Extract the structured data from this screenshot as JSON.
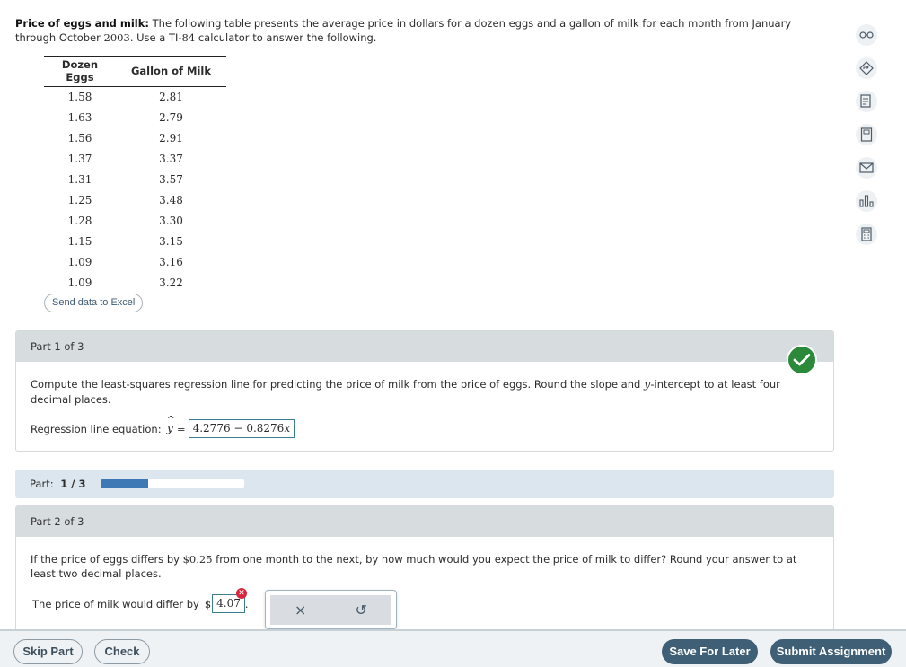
{
  "intro": {
    "title": "Price of eggs and milk:",
    "text_a": " The following table presents the average price in dollars for a dozen eggs and a gallon of milk for each month from January through October ",
    "year": "2003",
    "text_b": ". Use a TI-",
    "model": "84",
    "text_c": " calculator to answer the following."
  },
  "table": {
    "headers": [
      "Dozen Eggs",
      "Gallon of Milk"
    ],
    "rows": [
      [
        "1.58",
        "2.81"
      ],
      [
        "1.63",
        "2.79"
      ],
      [
        "1.56",
        "2.91"
      ],
      [
        "1.37",
        "3.37"
      ],
      [
        "1.31",
        "3.57"
      ],
      [
        "1.25",
        "3.48"
      ],
      [
        "1.28",
        "3.30"
      ],
      [
        "1.15",
        "3.15"
      ],
      [
        "1.09",
        "3.16"
      ],
      [
        "1.09",
        "3.22"
      ]
    ]
  },
  "send_excel_label": "Send data to Excel",
  "part1": {
    "heading": "Part 1 of 3",
    "q_a": "Compute the least-squares regression line for predicting the price of milk from the price of eggs. Round the slope and ",
    "q_var": "y",
    "q_b": "-intercept to at least four decimal places.",
    "eq_label": "Regression line equation:",
    "yhat_var": "y",
    "yhat_hat": "^",
    "equals": "=",
    "answer_intercept": "4.2776",
    "answer_minus": "−",
    "answer_slope": "0.8276",
    "answer_x": "x",
    "status": "correct"
  },
  "progress": {
    "label": "Part:",
    "value_text": "1 / 3",
    "fraction": 0.3333
  },
  "part2": {
    "heading": "Part 2 of 3",
    "q_a": "If the price of eggs differs by ",
    "q_amount": "$0.25",
    "q_b": " from one month to the next, by how much would you expect the price of milk to differ? Round your answer to at least two decimal places.",
    "answer_label": "The price of milk would differ by",
    "currency": "$",
    "answer_value": "4.07",
    "answer_suffix": ".",
    "status": "incorrect"
  },
  "popup": {
    "clear_icon": "×",
    "undo_icon": "↺"
  },
  "footer": {
    "skip_label": "Skip Part",
    "check_label": "Check",
    "save_label": "Save For Later",
    "submit_label": "Submit Assignment"
  },
  "side_icons": [
    "glasses-icon",
    "diamond-arrow-icon",
    "notes-icon",
    "book-icon",
    "mail-icon",
    "bar-chart-icon",
    "calculator-icon"
  ],
  "colors": {
    "accent_dark": "#3e5f75",
    "success": "#2a8a3a",
    "error": "#d7263d",
    "progress": "#3f79b5"
  }
}
